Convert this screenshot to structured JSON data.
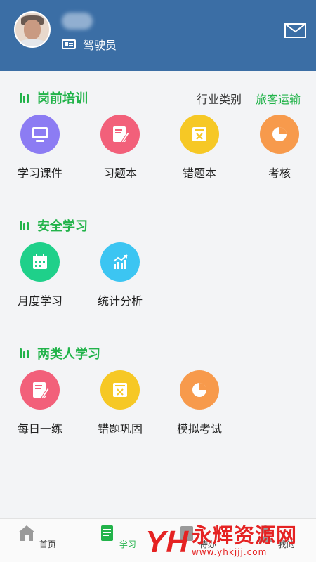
{
  "header": {
    "role": "驾驶员",
    "colors": {
      "background": "#3b6ea5"
    }
  },
  "sections": {
    "pre_job": {
      "title": "岗前培训",
      "category_label": "行业类别",
      "category_value": "旅客运输",
      "items": [
        {
          "label": "学习课件",
          "icon": "monitor-icon",
          "color": "#8c7cf3"
        },
        {
          "label": "习题本",
          "icon": "notebook-edit-icon",
          "color": "#f2607a"
        },
        {
          "label": "错题本",
          "icon": "wrong-book-icon",
          "color": "#f6c825"
        },
        {
          "label": "考核",
          "icon": "pie-chart-icon",
          "color": "#f79a4c"
        }
      ]
    },
    "safety": {
      "title": "安全学习",
      "items": [
        {
          "label": "月度学习",
          "icon": "calendar-icon",
          "color": "#1fd08a"
        },
        {
          "label": "统计分析",
          "icon": "stats-chart-icon",
          "color": "#3cc5f2"
        }
      ]
    },
    "two_types": {
      "title": "两类人学习",
      "items": [
        {
          "label": "每日一练",
          "icon": "notebook-edit-icon",
          "color": "#f2607a"
        },
        {
          "label": "错题巩固",
          "icon": "wrong-book-icon",
          "color": "#f6c825"
        },
        {
          "label": "模拟考试",
          "icon": "pie-chart-icon",
          "color": "#f79a4c"
        }
      ]
    }
  },
  "nav": {
    "home": "首页",
    "study": "学习",
    "todo": "待办",
    "mine": "我的"
  },
  "watermark": {
    "logo_text": "YH",
    "title": "永辉资源网",
    "url": "www.yhkjjj.com"
  },
  "colors": {
    "accent": "#22b34a"
  }
}
